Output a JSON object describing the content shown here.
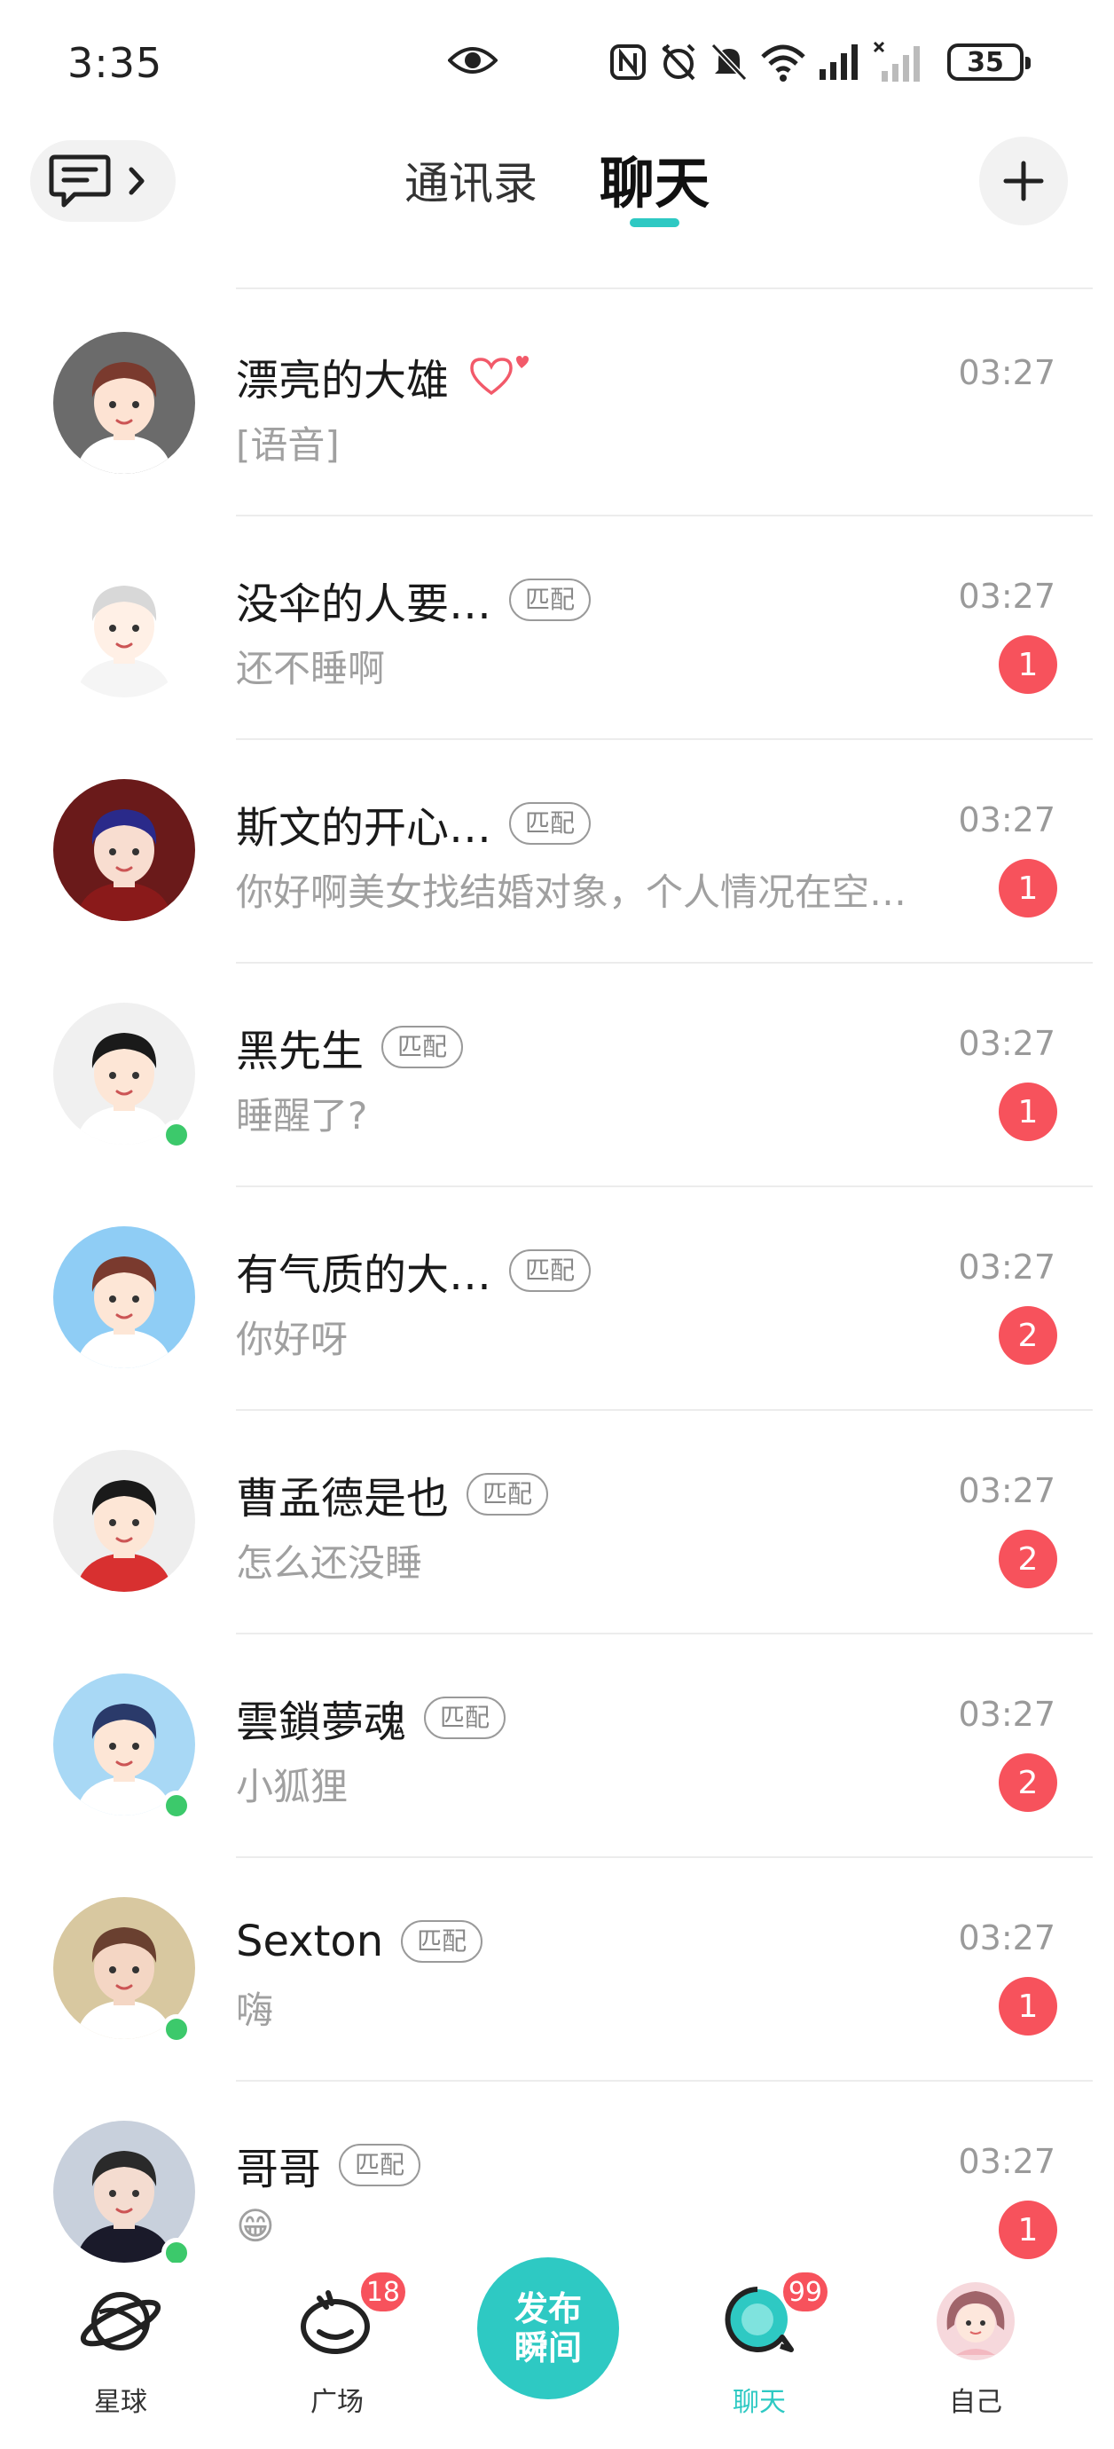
{
  "status_bar": {
    "time": "3:35",
    "battery": "35"
  },
  "header": {
    "tabs": [
      {
        "label": "通讯录",
        "active": false
      },
      {
        "label": "聊天",
        "active": true
      }
    ],
    "accent_color": "#2ec9c3"
  },
  "chats": [
    {
      "name": "漂亮的大雄",
      "tag": "",
      "heart": true,
      "preview": "[语音]",
      "time": "03:27",
      "unread": "",
      "online": false
    },
    {
      "name": "没伞的人要…",
      "tag": "匹配",
      "heart": false,
      "preview": "还不睡啊",
      "time": "03:27",
      "unread": "1",
      "online": false
    },
    {
      "name": "斯文的开心…",
      "tag": "匹配",
      "heart": false,
      "preview": "你好啊美女找结婚对象，个人情况在空…",
      "time": "03:27",
      "unread": "1",
      "online": false
    },
    {
      "name": "黑先生",
      "tag": "匹配",
      "heart": false,
      "preview": "睡醒了?",
      "time": "03:27",
      "unread": "1",
      "online": true
    },
    {
      "name": "有气质的大…",
      "tag": "匹配",
      "heart": false,
      "preview": "你好呀",
      "time": "03:27",
      "unread": "2",
      "online": false
    },
    {
      "name": "曹孟德是也",
      "tag": "匹配",
      "heart": false,
      "preview": "怎么还没睡",
      "time": "03:27",
      "unread": "2",
      "online": false
    },
    {
      "name": "雲鎖夢魂",
      "tag": "匹配",
      "heart": false,
      "preview": "小狐狸",
      "time": "03:27",
      "unread": "2",
      "online": true
    },
    {
      "name": "Sexton",
      "tag": "匹配",
      "heart": false,
      "preview": "嗨",
      "time": "03:27",
      "unread": "1",
      "online": true
    },
    {
      "name": "哥哥",
      "tag": "匹配",
      "heart": false,
      "preview": "😁",
      "time": "03:27",
      "unread": "1",
      "online": true
    }
  ],
  "bottom_nav": {
    "items": [
      {
        "label": "星球",
        "badge": "",
        "icon": "planet-icon"
      },
      {
        "label": "广场",
        "badge": "18",
        "icon": "square-icon"
      },
      {
        "label": "聊天",
        "badge": "99",
        "icon": "chat-icon"
      },
      {
        "label": "自己",
        "badge": "",
        "icon": "profile-avatar"
      }
    ],
    "publish_line1": "发布",
    "publish_line2": "瞬间"
  }
}
